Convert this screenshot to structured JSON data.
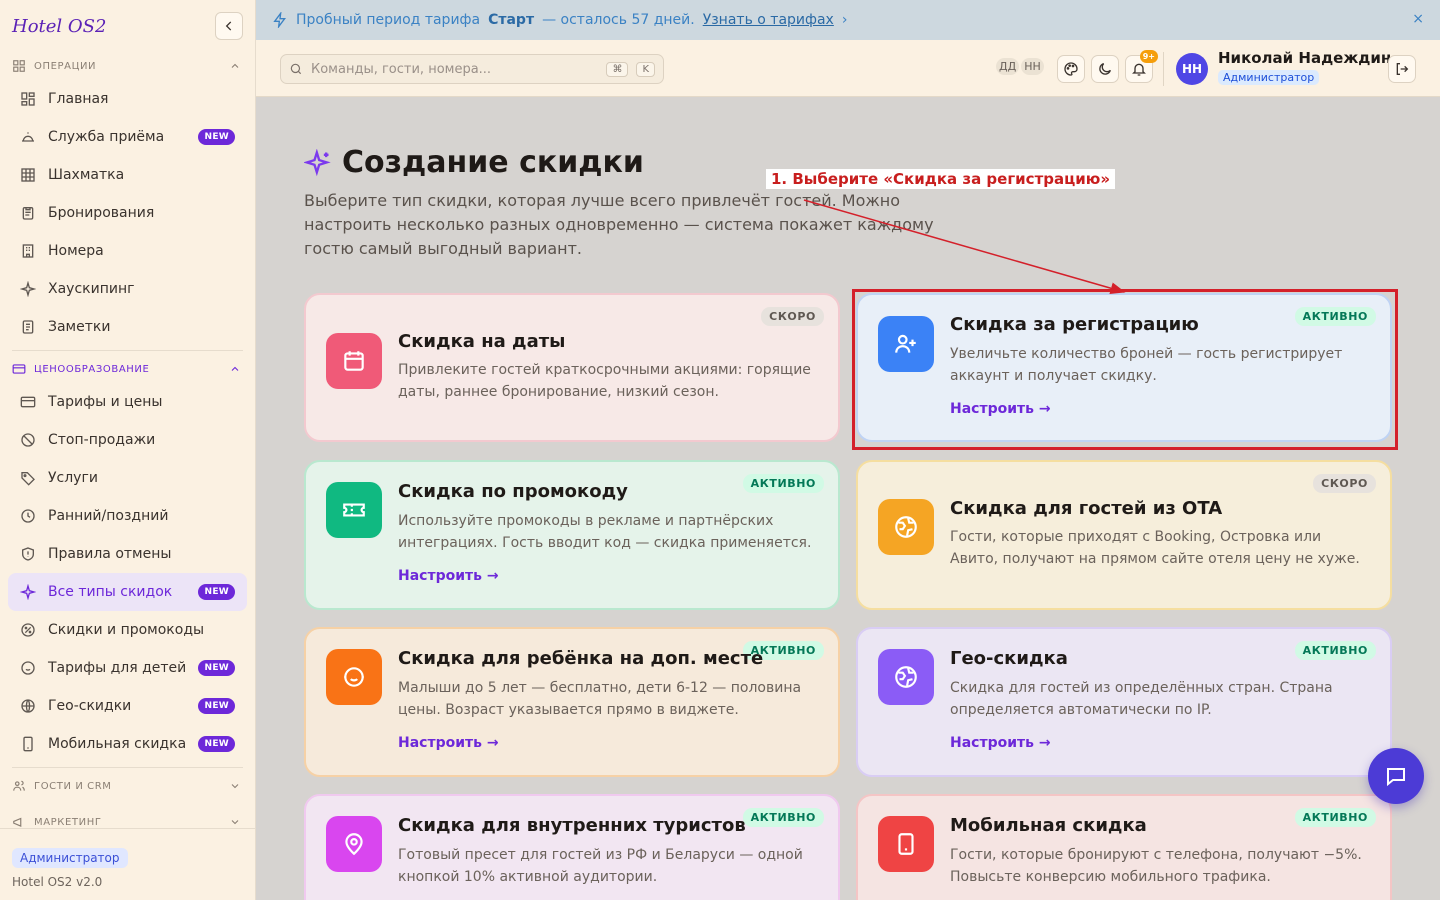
{
  "sidebar": {
    "logo": "Hotel OS2",
    "sections": [
      {
        "title": "ОПЕРАЦИИ",
        "items": [
          {
            "label": "Главная",
            "icon": "dashboard-icon"
          },
          {
            "label": "Служба приёма",
            "icon": "bell-desk-icon",
            "badge": "NEW"
          },
          {
            "label": "Шахматка",
            "icon": "grid-icon"
          },
          {
            "label": "Бронирования",
            "icon": "clipboard-icon"
          },
          {
            "label": "Номера",
            "icon": "building-icon"
          },
          {
            "label": "Хаускипинг",
            "icon": "sparkle-icon"
          },
          {
            "label": "Заметки",
            "icon": "note-icon"
          }
        ]
      },
      {
        "title": "ЦЕНООБРАЗОВАНИЕ",
        "items": [
          {
            "label": "Тарифы и цены",
            "icon": "card-icon"
          },
          {
            "label": "Стоп-продажи",
            "icon": "ban-icon"
          },
          {
            "label": "Услуги",
            "icon": "tag-icon"
          },
          {
            "label": "Ранний/поздний",
            "icon": "clock-icon"
          },
          {
            "label": "Правила отмены",
            "icon": "shield-icon"
          },
          {
            "label": "Все типы скидок",
            "icon": "sparkle-icon",
            "badge": "NEW",
            "active": true
          },
          {
            "label": "Скидки и промокоды",
            "icon": "percent-icon"
          },
          {
            "label": "Тарифы для детей",
            "icon": "baby-icon",
            "badge": "NEW"
          },
          {
            "label": "Гео-скидки",
            "icon": "globe-icon",
            "badge": "NEW"
          },
          {
            "label": "Мобильная скидка",
            "icon": "phone-icon",
            "badge": "NEW"
          }
        ]
      },
      {
        "title": "ГОСТИ И CRM"
      },
      {
        "title": "МАРКЕТИНГ"
      }
    ],
    "footer": {
      "role": "Администратор",
      "version": "Hotel OS2 v2.0"
    }
  },
  "banner": {
    "prefix": "Пробный период тарифа",
    "plan": "Старт",
    "suffix": "— осталось 57 дней.",
    "link": "Узнать о тарифах",
    "link_arrow": "›",
    "close": "×"
  },
  "topbar": {
    "search_placeholder": "Команды, гости, номера...",
    "kbd_1": "⌘",
    "kbd_2": "K",
    "presence_1": "ДД",
    "presence_2": "НН",
    "notif_count": "9+",
    "avatar_initials": "НН",
    "user_name": "Николай Надеждин",
    "user_role": "Администратор"
  },
  "page": {
    "title": "Создание скидки",
    "description": "Выберите тип скидки, которая лучше всего привлечёт гостей. Можно настроить несколько разных одновременно — система покажет каждому гостю самый выгодный вариант."
  },
  "annotation": {
    "text": "1. Выберите «Скидка за регистрацию»"
  },
  "cards": [
    {
      "title": "Скидка на даты",
      "desc": "Привлеките гостей краткосрочными акциями: горящие даты, раннее бронирование, низкий сезон.",
      "status": "СКОРО",
      "cta": "",
      "color": "#f05a78",
      "icon": "calendar-icon"
    },
    {
      "title": "Скидка за регистрацию",
      "desc": "Увеличьте количество броней — гость регистрирует аккаунт и получает скидку.",
      "status": "АКТИВНО",
      "cta": "Настроить →",
      "color": "#3b82f6",
      "icon": "user-plus-icon"
    },
    {
      "title": "Скидка по промокоду",
      "desc": "Используйте промокоды в рекламе и партнёрских интеграциях. Гость вводит код — скидка применяется.",
      "status": "АКТИВНО",
      "cta": "Настроить →",
      "color": "#10b981",
      "icon": "ticket-icon"
    },
    {
      "title": "Скидка для гостей из OTA",
      "desc": "Гости, которые приходят с Booking, Островка или Авито, получают на прямом сайте отеля цену не хуже.",
      "status": "СКОРО",
      "cta": "",
      "color": "#f5a524",
      "icon": "globe-icon"
    },
    {
      "title": "Скидка для ребёнка на доп. месте",
      "desc": "Малыши до 5 лет — бесплатно, дети 6-12 — половина цены. Возраст указывается прямо в виджете.",
      "status": "АКТИВНО",
      "cta": "Настроить →",
      "color": "#f97316",
      "icon": "baby-icon"
    },
    {
      "title": "Гео-скидка",
      "desc": "Скидка для гостей из определённых стран. Страна определяется автоматически по IP.",
      "status": "АКТИВНО",
      "cta": "Настроить →",
      "color": "#8b5cf6",
      "icon": "globe-icon"
    },
    {
      "title": "Скидка для внутренних туристов",
      "desc": "Готовый пресет для гостей из РФ и Беларуси — одной кнопкой 10% активной аудитории.",
      "status": "АКТИВНО",
      "cta": "",
      "color": "#d946ef",
      "icon": "map-pin-icon"
    },
    {
      "title": "Мобильная скидка",
      "desc": "Гости, которые бронируют с телефона, получают −5%. Повысьте конверсию мобильного трафика.",
      "status": "АКТИВНО",
      "cta": "",
      "color": "#ef4444",
      "icon": "phone-icon"
    }
  ]
}
